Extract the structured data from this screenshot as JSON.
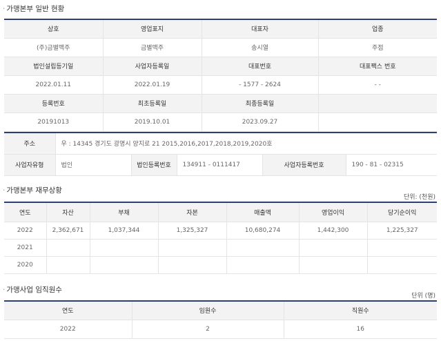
{
  "general": {
    "title": "가맹본부 일반 현황",
    "headers1": [
      "상호",
      "영업표지",
      "대표자",
      "업종"
    ],
    "values1": [
      "(주)금별맥주",
      "금별맥주",
      "송시열",
      "주점"
    ],
    "headers2": [
      "법인설립등기일",
      "사업자등록일",
      "대표번호",
      "대표팩스 번호"
    ],
    "values2": [
      "2022.01.11",
      "2022.01.19",
      "- 1577 - 2624",
      "- -"
    ],
    "headers3": [
      "등록번호",
      "최초등록일",
      "최종등록일",
      ""
    ],
    "values3": [
      "20191013",
      "2019.10.01",
      "2023.09.27",
      ""
    ]
  },
  "address": {
    "address_label": "주소",
    "address_value": "우 : 14345 경기도 광명시 양지로 21 2015,2016,2017,2018,2019,2020호",
    "biz_type_label": "사업자유형",
    "biz_type_value": "법인",
    "corp_reg_label": "법인등록번호",
    "corp_reg_value": "134911 - 0111417",
    "biz_reg_label": "사업자등록번호",
    "biz_reg_value": "190 - 81 - 02315"
  },
  "finance": {
    "title": "가맹본부 재무상황",
    "unit": "단위: (천원)",
    "headers": [
      "연도",
      "자산",
      "부채",
      "자본",
      "매출액",
      "영업이익",
      "당기순이익"
    ],
    "rows": [
      [
        "2022",
        "2,362,671",
        "1,037,344",
        "1,325,327",
        "10,680,274",
        "1,442,300",
        "1,225,327"
      ],
      [
        "2021",
        "",
        "",
        "",
        "",
        "",
        ""
      ],
      [
        "2020",
        "",
        "",
        "",
        "",
        "",
        ""
      ]
    ]
  },
  "staff": {
    "title": "가맹사업 임직원수",
    "unit": "단위 (명)",
    "headers": [
      "연도",
      "임원수",
      "직원수"
    ],
    "rows": [
      [
        "2022",
        "2",
        "16"
      ]
    ]
  }
}
